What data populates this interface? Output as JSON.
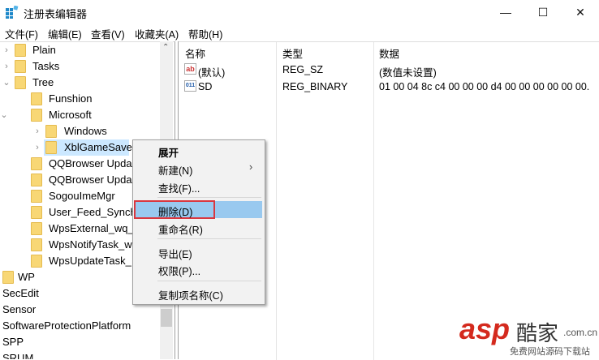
{
  "window": {
    "title": "注册表编辑器",
    "minimize": "—",
    "maximize": "☐",
    "close": "✕"
  },
  "menu": [
    "文件(F)",
    "编辑(E)",
    "查看(V)",
    "收藏夹(A)",
    "帮助(H)"
  ],
  "tree": [
    {
      "label": "Plain",
      "level": 0,
      "chev": "›",
      "folder": true
    },
    {
      "label": "Tasks",
      "level": 0,
      "chev": "›",
      "folder": true
    },
    {
      "label": "Tree",
      "level": 0,
      "chev": "⌄",
      "folder": true
    },
    {
      "label": "Funshion",
      "level": 1,
      "chev": "",
      "folder": true
    },
    {
      "label": "Microsoft",
      "level": 1,
      "chev": "⌄",
      "folder": true
    },
    {
      "label": "Windows",
      "level": 2,
      "chev": "›",
      "folder": true
    },
    {
      "label": "XblGameSave",
      "level": 2,
      "chev": "›",
      "folder": true,
      "selected": true
    },
    {
      "label": "QQBrowser Upda",
      "level": 1,
      "chev": "",
      "folder": true
    },
    {
      "label": "QQBrowser Upda",
      "level": 1,
      "chev": "",
      "folder": true
    },
    {
      "label": "SogouImeMgr",
      "level": 1,
      "chev": "",
      "folder": true
    },
    {
      "label": "User_Feed_Synch",
      "level": 1,
      "chev": "",
      "folder": true
    },
    {
      "label": "WpsExternal_wq_",
      "level": 1,
      "chev": "",
      "folder": true
    },
    {
      "label": "WpsNotifyTask_w",
      "level": 1,
      "chev": "",
      "folder": true
    },
    {
      "label": "WpsUpdateTask_",
      "level": 1,
      "chev": "",
      "folder": true
    },
    {
      "label": "WP",
      "level": -1,
      "chev": "",
      "folder": true
    },
    {
      "label": "SecEdit",
      "level": -2,
      "chev": "",
      "folder": false
    },
    {
      "label": "Sensor",
      "level": -2,
      "chev": "",
      "folder": false
    },
    {
      "label": "SoftwareProtectionPlatform",
      "level": -2,
      "chev": "",
      "folder": false
    },
    {
      "label": "SPP",
      "level": -2,
      "chev": "",
      "folder": false
    },
    {
      "label": "SRUM",
      "level": -2,
      "chev": "",
      "folder": false
    }
  ],
  "list": {
    "headers": {
      "name": "名称",
      "type": "类型",
      "data": "数据"
    },
    "rows": [
      {
        "icon": "ab",
        "name": "(默认)",
        "type": "REG_SZ",
        "data": "(数值未设置)"
      },
      {
        "icon": "011",
        "name": "SD",
        "type": "REG_BINARY",
        "data": "01 00 04 8c c4 00 00 00 d4 00 00 00 00 00 00."
      }
    ]
  },
  "context_menu": {
    "expand": "展开",
    "new": "新建(N)",
    "new_arrow": "›",
    "find": "查找(F)...",
    "delete": "删除(D)",
    "rename": "重命名(R)",
    "export": "导出(E)",
    "permissions": "权限(P)...",
    "copy_key_name": "复制项名称(C)"
  },
  "watermark": {
    "brand": "asp酷家",
    "domain": ".com.cn",
    "slogan": "免费网站源码下载站"
  },
  "colors": {
    "selection": "#cce8ff",
    "menu_highlight": "#99c9ef",
    "annotation": "#d9373f"
  }
}
